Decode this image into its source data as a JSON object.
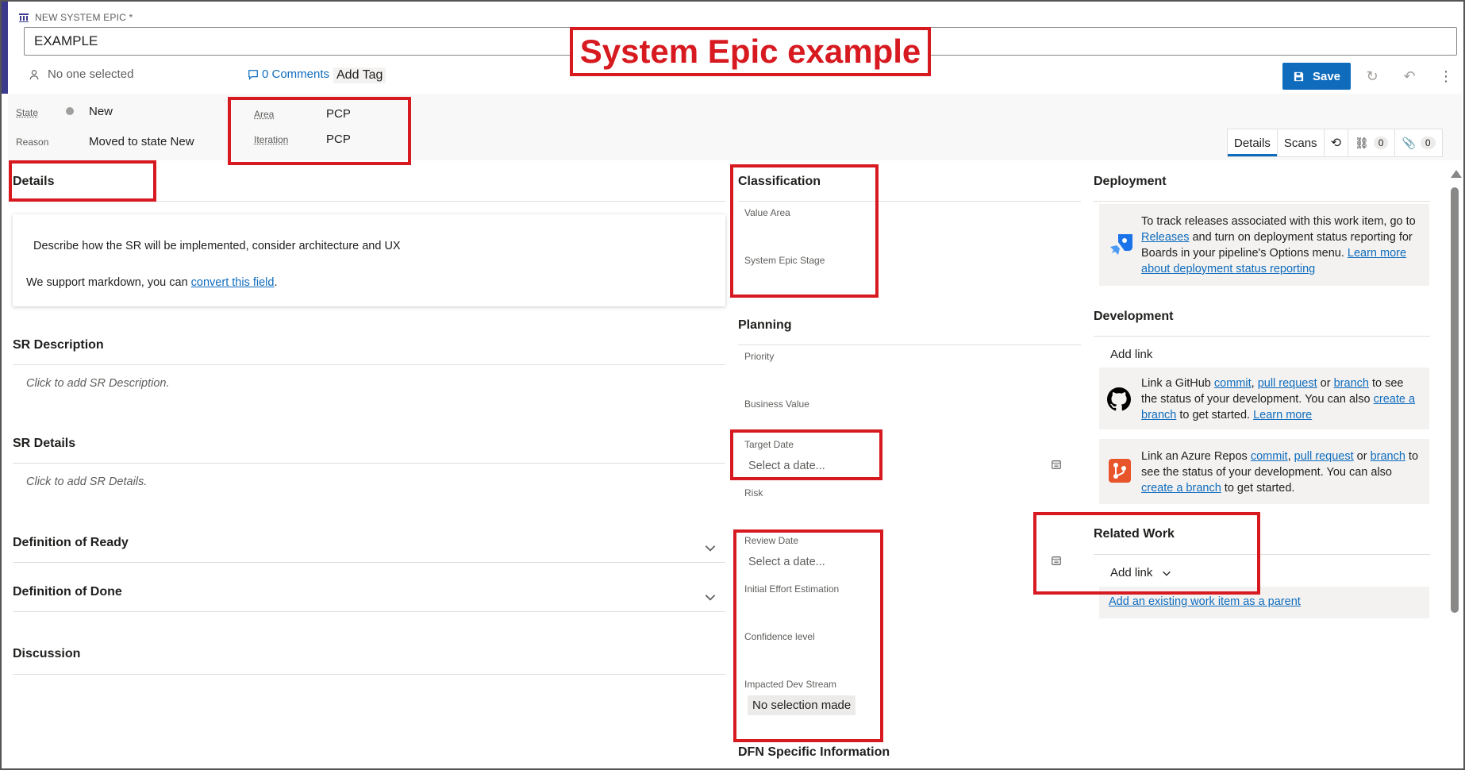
{
  "header": {
    "work_item_type": "NEW SYSTEM EPIC *",
    "title_value": "EXAMPLE",
    "assignee": "No one selected",
    "comments": "0 Comments",
    "add_tag": "Add Tag",
    "save_label": "Save"
  },
  "annotation_title": "System Epic example",
  "state_band": {
    "state_label": "State",
    "state_value": "New",
    "reason_label": "Reason",
    "reason_value": "Moved to state New",
    "area_label": "Area",
    "area_value": "PCP",
    "iteration_label": "Iteration",
    "iteration_value": "PCP"
  },
  "tabs": [
    {
      "label": "Details"
    },
    {
      "label": "Scans"
    },
    {
      "label": "",
      "icon": "history-icon"
    },
    {
      "label": "0",
      "icon": "link-icon"
    },
    {
      "label": "0",
      "icon": "attachment-icon"
    }
  ],
  "left": {
    "details_title": "Details",
    "details_line1": "Describe how the SR will be implemented, consider architecture and UX",
    "details_line2_prefix": "We support markdown, you can ",
    "details_line2_link": "convert this field",
    "details_line2_suffix": ".",
    "sr_description_title": "SR Description",
    "sr_description_placeholder": "Click to add SR Description.",
    "sr_details_title": "SR Details",
    "sr_details_placeholder": "Click to add SR Details.",
    "dor_title": "Definition of Ready",
    "dod_title": "Definition of Done",
    "discussion_title": "Discussion"
  },
  "middle": {
    "classification_title": "Classification",
    "value_area_label": "Value Area",
    "system_epic_stage_label": "System Epic Stage",
    "planning_title": "Planning",
    "priority_label": "Priority",
    "business_value_label": "Business Value",
    "target_date_label": "Target Date",
    "target_date_placeholder": "Select a date...",
    "risk_label": "Risk",
    "review_date_label": "Review Date",
    "review_date_placeholder": "Select a date...",
    "initial_effort_label": "Initial Effort Estimation",
    "confidence_label": "Confidence level",
    "impacted_dev_stream_label": "Impacted Dev Stream",
    "impacted_dev_stream_value": "No selection made",
    "dfn_title": "DFN Specific Information"
  },
  "right": {
    "deployment_title": "Deployment",
    "deployment_text_1": "To track releases associated with this work item, go to",
    "deployment_link_releases": "Releases",
    "deployment_text_2": " and turn on deployment status reporting for",
    "deployment_text_3": "Boards in your pipeline's Options menu. ",
    "deployment_link_learn": "Learn more",
    "deployment_link_learn2": "about deployment status reporting",
    "development_title": "Development",
    "add_link": "Add link",
    "github_text_1": "Link a GitHub ",
    "github_commit": "commit",
    "comma": ", ",
    "github_pr": "pull request",
    "or": " or ",
    "github_branch": "branch",
    "github_text_2": " to see",
    "github_text_3": "the status of your development. You can also ",
    "github_create": "create a",
    "github_create2": "branch",
    "github_text_4": " to get started. ",
    "github_learn": "Learn more",
    "azure_text_1": "Link an Azure Repos ",
    "azure_commit": "commit",
    "azure_pr": "pull request",
    "azure_branch": "branch",
    "azure_text_2": " to",
    "azure_text_3": "see the status of your development. You can also",
    "azure_create": "create a branch",
    "azure_text_4": " to get started.",
    "related_work_title": "Related Work",
    "related_add_link": "Add link",
    "add_existing_parent": "Add an existing work item as a parent"
  },
  "colors": {
    "accent": "#0f6cbd",
    "annotation_red": "#d71920",
    "epic_bar": "#3b3a8c"
  }
}
